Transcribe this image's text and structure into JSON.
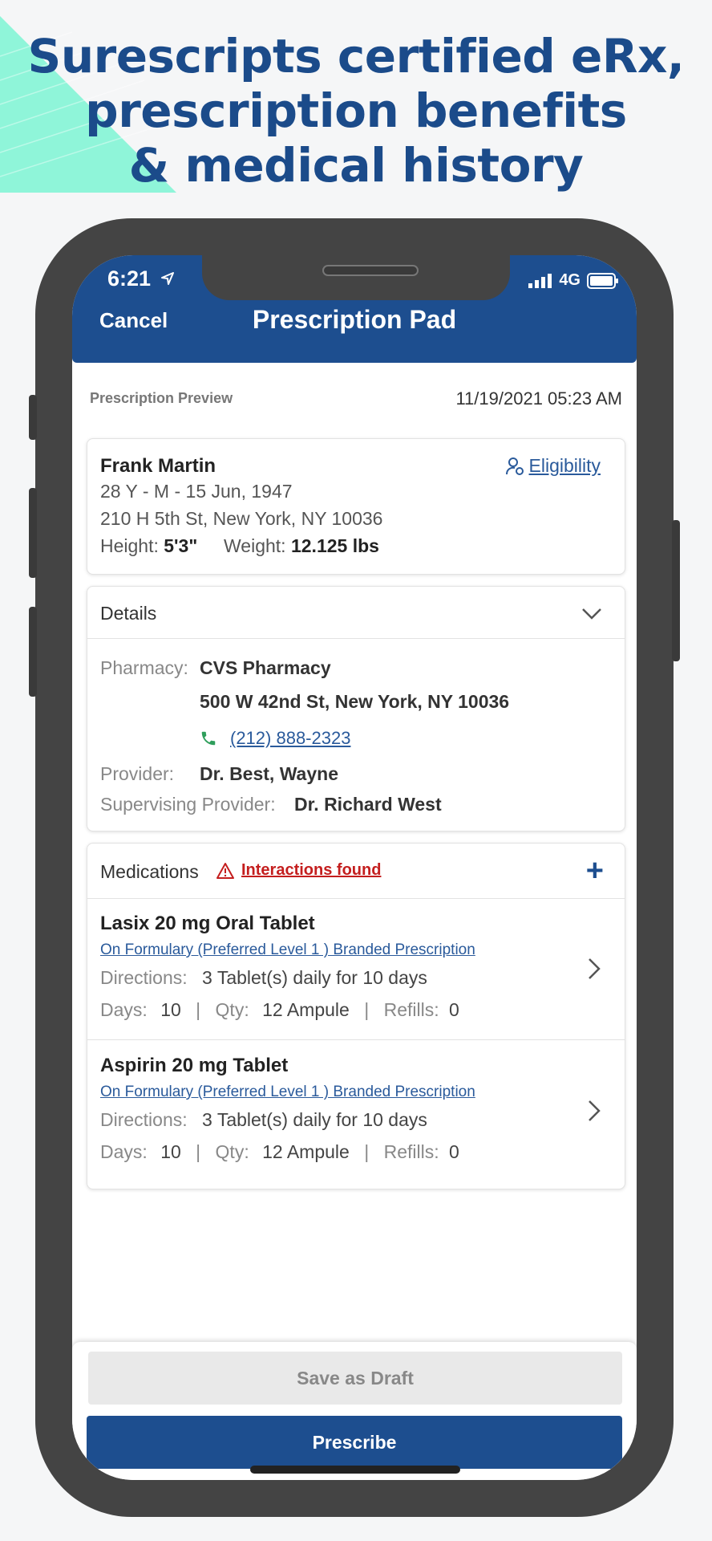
{
  "marketing": {
    "headline_line1": "Surescripts certified eRx,",
    "headline_line2": "prescription benefits",
    "headline_line3": "& medical history"
  },
  "status_bar": {
    "time": "6:21",
    "network": "4G"
  },
  "header": {
    "cancel_label": "Cancel",
    "title": "Prescription Pad"
  },
  "preview": {
    "label": "Prescription Preview",
    "datetime": "11/19/2021 05:23 AM"
  },
  "patient": {
    "name": "Frank Martin",
    "demographics": "28 Y - M - 15 Jun, 1947",
    "address": "210 H 5th St, New York, NY 10036",
    "height_label": "Height:",
    "height_value": "5'3\"",
    "weight_label": "Weight:",
    "weight_value": "12.125 lbs",
    "eligibility_label": "Eligibility"
  },
  "details": {
    "title": "Details",
    "pharmacy_label": "Pharmacy:",
    "pharmacy_name": "CVS Pharmacy",
    "pharmacy_address": "500 W 42nd St, New York, NY 10036",
    "pharmacy_phone": "(212) 888-2323",
    "provider_label": "Provider:",
    "provider_value": "Dr. Best, Wayne",
    "supervising_label": "Supervising Provider:",
    "supervising_value": "Dr. Richard West"
  },
  "medications": {
    "title": "Medications",
    "interactions_label": "Interactions found",
    "add_label": "+",
    "items": [
      {
        "name": "Lasix 20 mg Oral Tablet",
        "formulary": "On Formulary (Preferred Level 1 ) Branded Prescription",
        "directions_label": "Directions:",
        "directions": "3 Tablet(s) daily for 10 days",
        "days_label": "Days:",
        "days": "10",
        "qty_label": "Qty:",
        "qty": "12 Ampule",
        "refills_label": "Refills:",
        "refills": "0"
      },
      {
        "name": "Aspirin 20 mg Tablet",
        "formulary": "On Formulary (Preferred Level 1 ) Branded Prescription",
        "directions_label": "Directions:",
        "directions": "3 Tablet(s) daily for 10 days",
        "days_label": "Days:",
        "days": "10",
        "qty_label": "Qty:",
        "qty": "12 Ampule",
        "refills_label": "Refills:",
        "refills": "0"
      }
    ]
  },
  "footer": {
    "save_draft_label": "Save as Draft",
    "prescribe_label": "Prescribe"
  },
  "colors": {
    "brand_blue": "#1d4e8f",
    "link_blue": "#2a5a9b",
    "warning_red": "#c41e1e",
    "phone_green": "#2e9e5b",
    "accent_mint": "#8ff5d9"
  },
  "icons": {
    "location": "location-arrow-icon",
    "signal": "signal-bars-icon",
    "battery": "battery-icon",
    "eligibility": "person-check-icon",
    "collapse": "chevron-down-icon",
    "phone": "phone-icon",
    "warning": "warning-triangle-icon",
    "navigate": "chevron-right-icon"
  }
}
